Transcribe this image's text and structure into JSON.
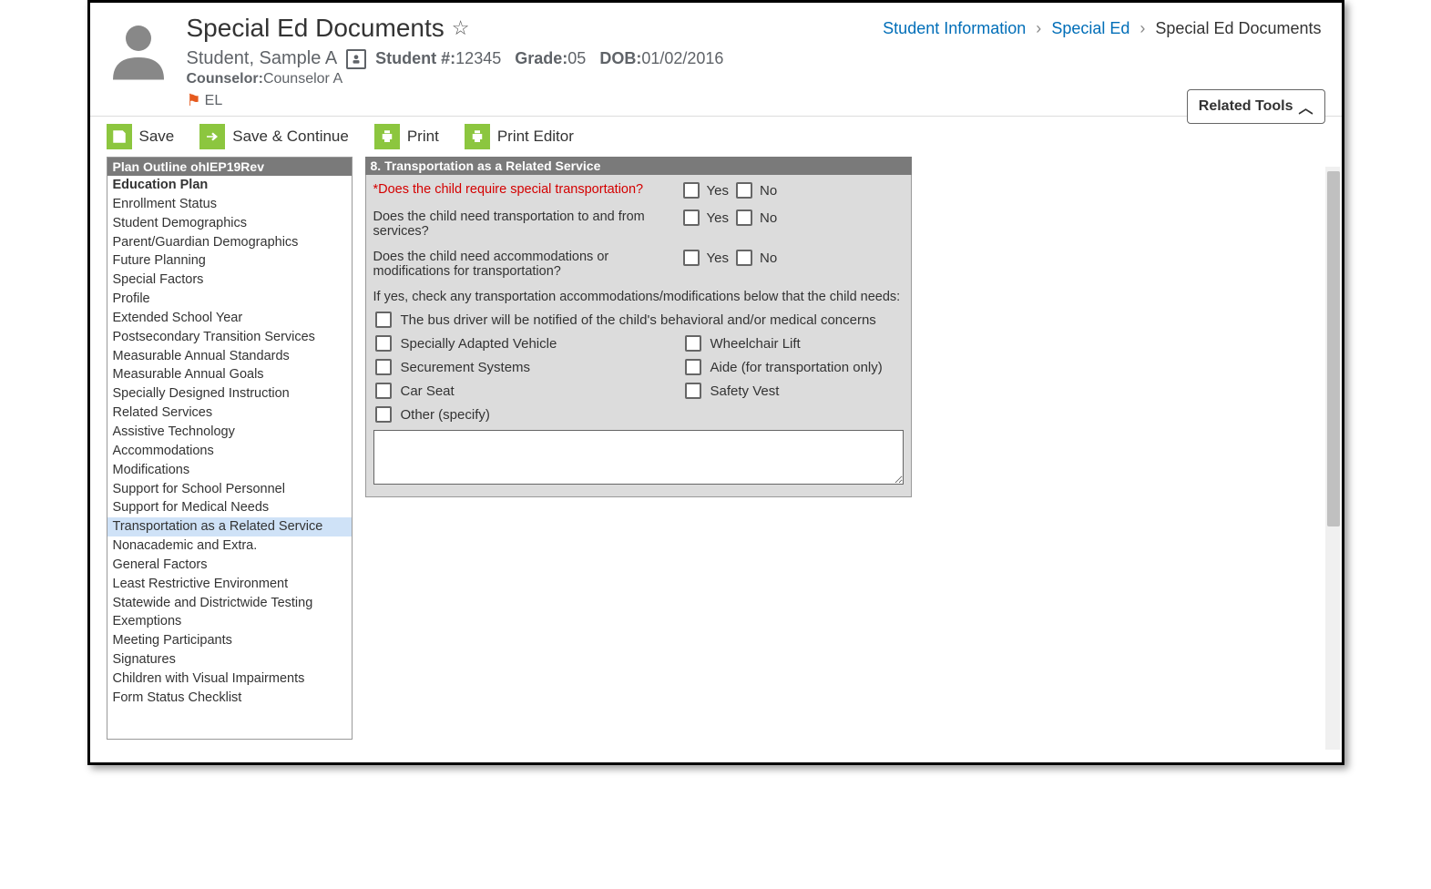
{
  "page": {
    "title": "Special Ed Documents"
  },
  "breadcrumbs": {
    "a": "Student Information",
    "b": "Special Ed",
    "c": "Special Ed Documents"
  },
  "student": {
    "name": "Student, Sample A",
    "number_label": "Student #:",
    "number_value": "12345",
    "grade_label": "Grade:",
    "grade_value": "05",
    "dob_label": "DOB:",
    "dob_value": "01/02/2016",
    "counselor_label": "Counselor:",
    "counselor_value": "Counselor A",
    "flag_label": "EL"
  },
  "related_tools": {
    "label": "Related Tools"
  },
  "toolbar": {
    "save": "Save",
    "save_continue": "Save & Continue",
    "print": "Print",
    "print_editor": "Print Editor"
  },
  "sidebar": {
    "header": "Plan Outline ohIEP19Rev",
    "items": [
      {
        "label": "Education Plan",
        "bold": true
      },
      {
        "label": "Enrollment Status"
      },
      {
        "label": "Student Demographics"
      },
      {
        "label": "Parent/Guardian Demographics"
      },
      {
        "label": "Future Planning"
      },
      {
        "label": "Special Factors"
      },
      {
        "label": "Profile"
      },
      {
        "label": "Extended School Year"
      },
      {
        "label": "Postsecondary Transition Services"
      },
      {
        "label": "Measurable Annual Standards"
      },
      {
        "label": "Measurable Annual Goals"
      },
      {
        "label": "Specially Designed Instruction"
      },
      {
        "label": "Related Services"
      },
      {
        "label": "Assistive Technology"
      },
      {
        "label": "Accommodations"
      },
      {
        "label": "Modifications"
      },
      {
        "label": "Support for School Personnel"
      },
      {
        "label": "Support for Medical Needs"
      },
      {
        "label": "Transportation as a Related Service",
        "selected": true
      },
      {
        "label": "Nonacademic and Extra."
      },
      {
        "label": "General Factors"
      },
      {
        "label": "Least Restrictive Environment"
      },
      {
        "label": "Statewide and Districtwide Testing"
      },
      {
        "label": "Exemptions"
      },
      {
        "label": "Meeting Participants"
      },
      {
        "label": "Signatures"
      },
      {
        "label": "Children with Visual Impairments"
      },
      {
        "label": "Form Status Checklist"
      }
    ]
  },
  "panel": {
    "header": "8. Transportation as a Related Service",
    "q1": "*Does the child require special transportation?",
    "q2": "Does the child need transportation to and from services?",
    "q3": "Does the child need accommodations or modifications for transportation?",
    "yes": "Yes",
    "no": "No",
    "instructions": "If yes, check any transportation accommodations/modifications below that the child needs:",
    "acc": {
      "notify": "The bus driver will be notified of the child's behavioral and/or medical concerns",
      "vehicle": "Specially Adapted Vehicle",
      "lift": "Wheelchair Lift",
      "secure": "Securement Systems",
      "aide": "Aide (for transportation only)",
      "carseat": "Car Seat",
      "vest": "Safety Vest",
      "other": "Other (specify)"
    },
    "other_text": ""
  }
}
